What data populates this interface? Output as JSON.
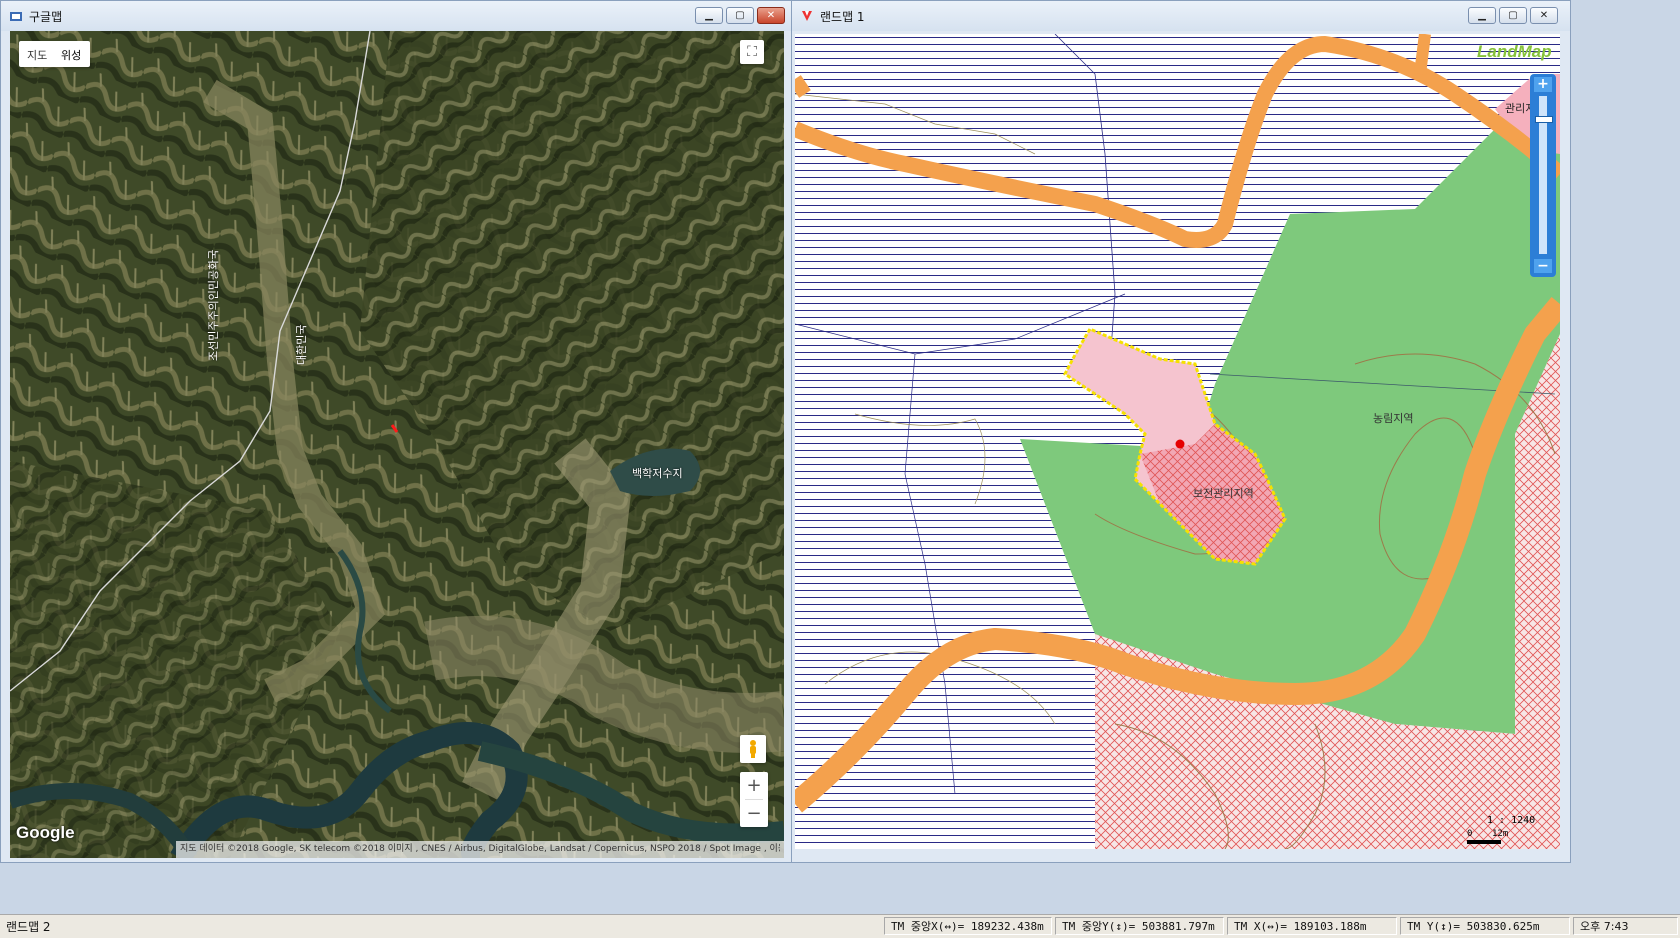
{
  "google_window": {
    "title": "구글맵",
    "map_type_tabs": [
      "지도",
      "위성"
    ],
    "labels": {
      "border_north": "조선민주주의인민공화국",
      "border_south": "대한민국",
      "reservoir": "백학저수지"
    },
    "logo": "Google",
    "attribution": "지도 데이터 ©2018 Google, SK telecom ©2018 이미지 , CNES / Airbus, DigitalGlobe, Landsat / Copernicus, NSPO 2018 / Spot Image , 이용약관",
    "controls": {
      "zoom_in": "+",
      "zoom_out": "−",
      "fullscreen": "⛶"
    }
  },
  "land_window": {
    "title": "랜드맵 1",
    "logo": "LandMap",
    "labels": {
      "conservation_area": "보전관리지역",
      "agri_forest_area": "농림지역",
      "management_area": "관리지"
    },
    "scale": {
      "ratio": "1 : 1240",
      "bar_start": "0",
      "bar_end": "12m"
    },
    "zoom_controls": {
      "zoom_in": "+",
      "zoom_out": "−"
    },
    "colors": {
      "road": "#f4a14d",
      "agri_green": "#7ec97c",
      "conservation_pink": "#f5c4cf",
      "hatch_red": "#e05555",
      "hatch_blue": "#2a2a86",
      "selection_yellow": "#f5e100"
    }
  },
  "statusbar": {
    "app_label": "랜드맵 2",
    "tm_center_x": "TM 중앙X(↔)= 189232.438m",
    "tm_center_y": "TM 중앙Y(↕)= 503881.797m",
    "tm_x": "TM X(↔)= 189103.188m",
    "tm_y": "TM Y(↕)= 503830.625m",
    "clock": "오후 7:43"
  }
}
